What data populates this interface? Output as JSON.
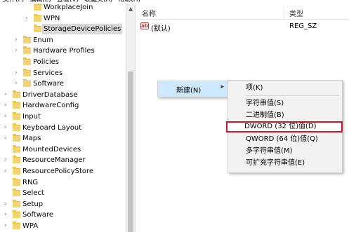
{
  "menubar": {
    "items": [
      "文件(F)",
      "编辑(E)",
      "查看(V)",
      "收藏夹(A)",
      "帮助(H)"
    ]
  },
  "tree": {
    "items": [
      {
        "label": "WorkplaceJoin",
        "level": 3,
        "expander": false,
        "selected": false
      },
      {
        "label": "WPN",
        "level": 3,
        "expander": true,
        "selected": false
      },
      {
        "label": "StorageDevicePolicies",
        "level": 3,
        "expander": false,
        "selected": true
      },
      {
        "label": "Enum",
        "level": 2,
        "expander": true,
        "selected": false
      },
      {
        "label": "Hardware Profiles",
        "level": 2,
        "expander": true,
        "selected": false
      },
      {
        "label": "Policies",
        "level": 2,
        "expander": false,
        "selected": false
      },
      {
        "label": "Services",
        "level": 2,
        "expander": true,
        "selected": false
      },
      {
        "label": "Software",
        "level": 2,
        "expander": true,
        "selected": false
      },
      {
        "label": "DriverDatabase",
        "level": 1,
        "expander": true,
        "selected": false
      },
      {
        "label": "HardwareConfig",
        "level": 1,
        "expander": true,
        "selected": false
      },
      {
        "label": "Input",
        "level": 1,
        "expander": true,
        "selected": false
      },
      {
        "label": "Keyboard Layout",
        "level": 1,
        "expander": true,
        "selected": false
      },
      {
        "label": "Maps",
        "level": 1,
        "expander": true,
        "selected": false
      },
      {
        "label": "MountedDevices",
        "level": 1,
        "expander": false,
        "selected": false
      },
      {
        "label": "ResourceManager",
        "level": 1,
        "expander": true,
        "selected": false
      },
      {
        "label": "ResourcePolicyStore",
        "level": 1,
        "expander": true,
        "selected": false
      },
      {
        "label": "RNG",
        "level": 1,
        "expander": false,
        "selected": false
      },
      {
        "label": "Select",
        "level": 1,
        "expander": false,
        "selected": false
      },
      {
        "label": "Setup",
        "level": 1,
        "expander": true,
        "selected": false
      },
      {
        "label": "Software",
        "level": 1,
        "expander": true,
        "selected": false
      },
      {
        "label": "WPA",
        "level": 1,
        "expander": true,
        "selected": false
      }
    ]
  },
  "list": {
    "columns": {
      "name": "名称",
      "type": "类型"
    },
    "rows": [
      {
        "icon": "ab",
        "name": "(默认)",
        "type": "REG_SZ"
      }
    ]
  },
  "context_menu": {
    "new_label": "新建(N)",
    "submenu": [
      {
        "label": "项(K)",
        "highlight": false,
        "sep_after": true
      },
      {
        "label": "字符串值(S)",
        "highlight": false,
        "sep_after": false
      },
      {
        "label": "二进制值(B)",
        "highlight": false,
        "sep_after": false
      },
      {
        "label": "DWORD (32 位)值(D)",
        "highlight": true,
        "sep_after": false
      },
      {
        "label": "QWORD (64 位)值(Q)",
        "highlight": false,
        "sep_after": false
      },
      {
        "label": "多字符串值(M)",
        "highlight": false,
        "sep_after": false
      },
      {
        "label": "可扩充字符串值(E)",
        "highlight": false,
        "sep_after": false
      }
    ]
  },
  "colors": {
    "highlight_border": "#d0142c",
    "menu_hover": "#cde8ff",
    "folder": "#f3d473"
  }
}
